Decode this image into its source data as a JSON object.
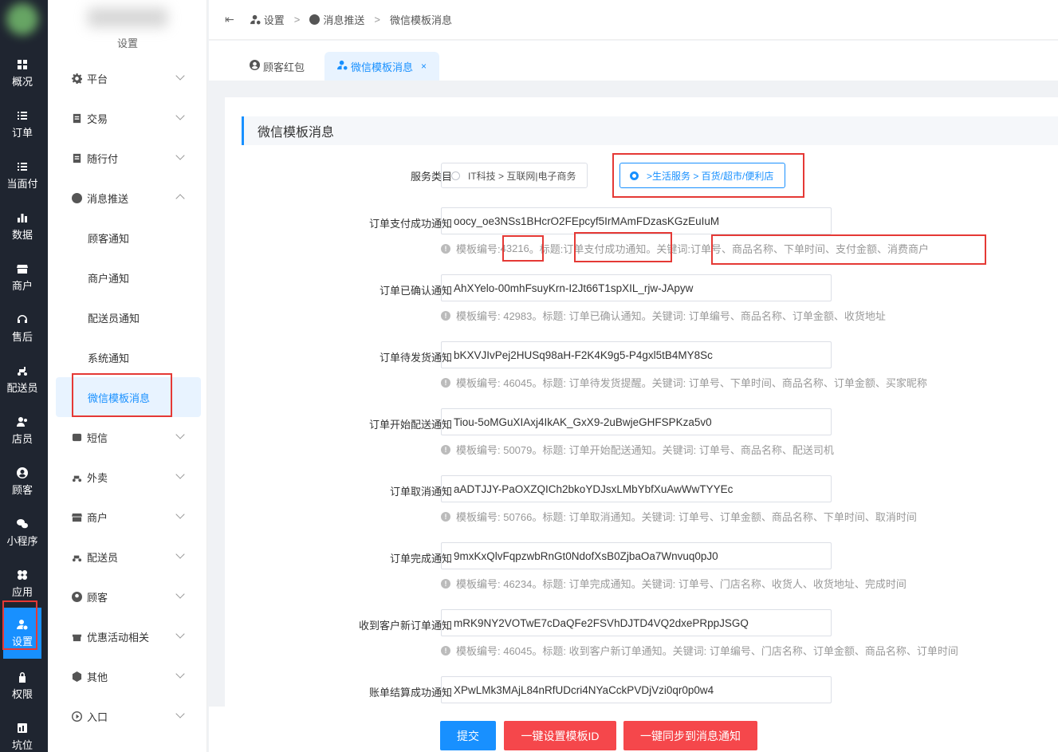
{
  "rail": {
    "items": [
      {
        "label": "概况",
        "icon": "dashboard-icon"
      },
      {
        "label": "订单",
        "icon": "list-icon"
      },
      {
        "label": "当面付",
        "icon": "list-icon"
      },
      {
        "label": "数据",
        "icon": "bar-chart-icon"
      },
      {
        "label": "商户",
        "icon": "store-icon"
      },
      {
        "label": "售后",
        "icon": "headset-icon"
      },
      {
        "label": "配送员",
        "icon": "scooter-icon"
      },
      {
        "label": "店员",
        "icon": "users-icon"
      },
      {
        "label": "顾客",
        "icon": "user-circle-icon"
      },
      {
        "label": "小程序",
        "icon": "wechat-icon"
      },
      {
        "label": "应用",
        "icon": "apps-icon"
      },
      {
        "label": "设置",
        "icon": "user-gear-icon"
      },
      {
        "label": "权限",
        "icon": "lock-icon"
      },
      {
        "label": "坑位",
        "icon": "slot-icon"
      }
    ],
    "active_index": 11
  },
  "submenu": {
    "title": "设置",
    "items": [
      {
        "label": "平台",
        "icon": "gear-icon"
      },
      {
        "label": "交易",
        "icon": "trade-icon"
      },
      {
        "label": "随行付",
        "icon": "trade-icon"
      },
      {
        "label": "消息推送",
        "icon": "message-icon"
      },
      {
        "label": "顾客通知"
      },
      {
        "label": "商户通知"
      },
      {
        "label": "配送员通知"
      },
      {
        "label": "系统通知"
      },
      {
        "label": "微信模板消息"
      },
      {
        "label": "短信",
        "icon": "sms-icon"
      },
      {
        "label": "外卖",
        "icon": "scooter-icon"
      },
      {
        "label": "商户",
        "icon": "store-icon"
      },
      {
        "label": "配送员",
        "icon": "scooter-icon"
      },
      {
        "label": "顾客",
        "icon": "user-circle-icon"
      },
      {
        "label": "优惠活动相关",
        "icon": "gift-icon"
      },
      {
        "label": "其他",
        "icon": "hexagon-icon"
      },
      {
        "label": "入口",
        "icon": "entry-icon"
      }
    ]
  },
  "header": {
    "fold_icon": "menu-fold-icon",
    "breadcrumb": [
      "设置",
      "消息推送",
      "微信模板消息"
    ],
    "separator": ">"
  },
  "tabs": [
    {
      "label": "顾客红包",
      "icon": "user-circle-icon"
    },
    {
      "label": "微信模板消息",
      "icon": "user-gear-icon",
      "close": "×"
    }
  ],
  "section_title": "微信模板消息",
  "service": {
    "label": "服务类目",
    "options": [
      "IT科技 > 互联网|电子商务",
      ">生活服务 > 百货/超市/便利店"
    ],
    "selected_index": 1
  },
  "templates": [
    {
      "label": "订单支付成功通知",
      "value": "oocy_oe3NSs1BHcrO2FEpcyf5IrMAmFDzasKGzEuIuM",
      "hint_prefix": "模板编号: ",
      "code": "43216",
      "hint_mid": "。标题: ",
      "title": "订单支付成功通知",
      "hint_mid2": "。关键词: ",
      "keywords": "订单号、商品名称、下单时间、支付金额、消费商户"
    },
    {
      "label": "订单已确认通知",
      "value": "AhXYelo-00mhFsuyKrn-I2Jt66T1spXIL_rjw-JApyw",
      "hint": "模板编号: 42983。标题: 订单已确认通知。关键词: 订单编号、商品名称、订单金额、收货地址"
    },
    {
      "label": "订单待发货通知",
      "value": "bKXVJIvPej2HUSq98aH-F2K4K9g5-P4gxl5tB4MY8Sc",
      "hint": "模板编号: 46045。标题: 订单待发货提醒。关键词: 订单号、下单时间、商品名称、订单金额、买家昵称"
    },
    {
      "label": "订单开始配送通知",
      "value": "Tiou-5oMGuXIAxj4IkAK_GxX9-2uBwjeGHFSPKza5v0",
      "hint": "模板编号: 50079。标题: 订单开始配送通知。关键词: 订单号、商品名称、配送司机"
    },
    {
      "label": "订单取消通知",
      "value": "aADTJJY-PaOXZQICh2bkoYDJsxLMbYbfXuAwWwTYYEc",
      "hint": "模板编号: 50766。标题: 订单取消通知。关键词: 订单号、订单金额、商品名称、下单时间、取消时间"
    },
    {
      "label": "订单完成通知",
      "value": "9mxKxQlvFqpzwbRnGt0NdofXsB0ZjbaOa7Wnvuq0pJ0",
      "hint": "模板编号: 46234。标题: 订单完成通知。关键词: 订单号、门店名称、收货人、收货地址、完成时间"
    },
    {
      "label": "收到客户新订单通知",
      "value": "mRK9NY2VOTwE7cDaQFe2FSVhDJTD4VQ2dxePRppJSGQ",
      "hint": "模板编号: 46045。标题: 收到客户新订单通知。关键词: 订单编号、门店名称、订单金额、商品名称、订单时间"
    },
    {
      "label": "账单结算成功通知",
      "value": "XPwLMk3MAjL84nRfUDcri4NYaCckPVDjVzi0qr0p0w4"
    }
  ],
  "buttons": {
    "submit": "提交",
    "set_template": "一键设置模板ID",
    "sync": "一键同步到消息通知"
  },
  "colors": {
    "primary": "#1890ff",
    "rail_bg": "#1f2530",
    "danger": "#f5474b",
    "highlight_box": "#e53935"
  }
}
